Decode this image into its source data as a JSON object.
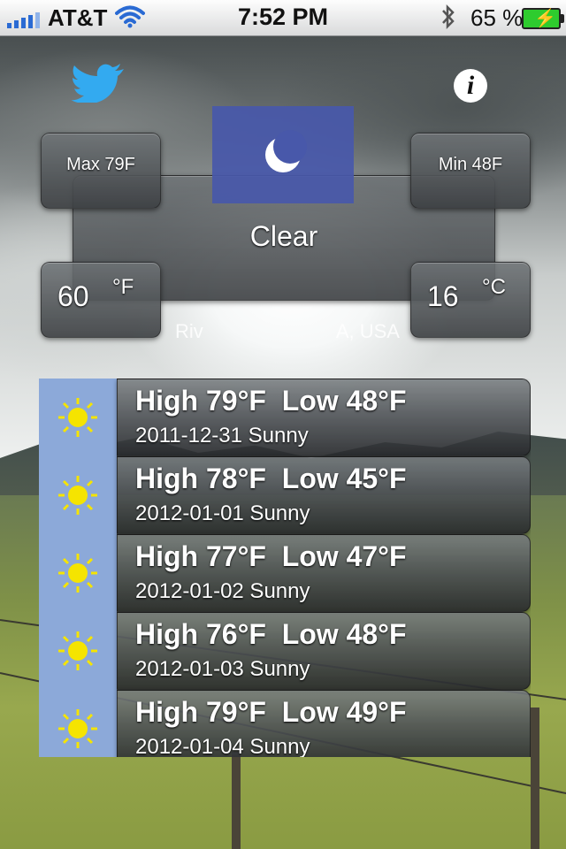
{
  "status_bar": {
    "carrier": "AT&T",
    "time": "7:52 PM",
    "battery_percent": "65 %",
    "icons": [
      "signal-icon",
      "wifi-icon",
      "bluetooth-icon",
      "battery-charging-icon"
    ]
  },
  "header": {
    "icons": [
      "twitter-icon",
      "info-icon"
    ]
  },
  "current": {
    "max": "Max 79F",
    "min": "Min 48F",
    "condition": "Clear",
    "condition_icon": "moon-icon",
    "temp_f": "60",
    "unit_f": "°F",
    "temp_c": "16",
    "unit_c": "°C",
    "location": "Riv",
    "location_tail": "A, USA"
  },
  "forecast": [
    {
      "high_low": "High 79°F  Low 48°F",
      "date_cond": "2011-12-31 Sunny",
      "icon": "sun-icon"
    },
    {
      "high_low": "High 78°F  Low 45°F",
      "date_cond": "2012-01-01 Sunny",
      "icon": "sun-icon"
    },
    {
      "high_low": "High 77°F  Low 47°F",
      "date_cond": "2012-01-02 Sunny",
      "icon": "sun-icon"
    },
    {
      "high_low": "High 76°F  Low 48°F",
      "date_cond": "2012-01-03 Sunny",
      "icon": "sun-icon"
    },
    {
      "high_low": "High 79°F  Low 49°F",
      "date_cond": "2012-01-04 Sunny",
      "icon": "sun-icon"
    }
  ],
  "colors": {
    "status_bar_bg": "#e8e9ea",
    "moon_tile": "#4858aa",
    "forecast_icon_column": "#8ca9d9",
    "sun": "#f5e400",
    "twitter": "#33aaf0"
  }
}
